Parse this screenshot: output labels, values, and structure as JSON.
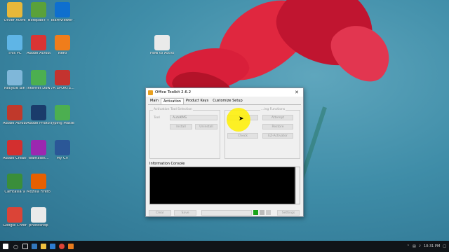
{
  "desktop": {
    "icons": [
      {
        "label": "Oliver Autre",
        "icon": "folder-icon",
        "color": "#e8b83a"
      },
      {
        "label": "Notepad++",
        "icon": "notepad-plus-plus-icon",
        "color": "#5aa13a"
      },
      {
        "label": "TeamViewer 11",
        "icon": "teamviewer-icon",
        "color": "#0e6fcf"
      },
      {
        "label": "This PC",
        "icon": "computer-icon",
        "color": "#5fb5e6"
      },
      {
        "label": "Adobe Acrobat X",
        "icon": "adobe-acrobat-icon",
        "color": "#d93434"
      },
      {
        "label": "Nero",
        "icon": "nero-icon",
        "color": "#f07d1b"
      },
      {
        "label": "How to Activate...",
        "icon": "document-icon",
        "color": "#eaeaea"
      },
      {
        "label": "Recycle Bin",
        "icon": "recycle-bin-icon",
        "color": "#7fb7d9"
      },
      {
        "label": "Internet Downlo...",
        "icon": "internet-download-manager-icon",
        "color": "#4caf50"
      },
      {
        "label": "7A SPORTS...",
        "icon": "cricket-game-icon",
        "color": "#c4332f"
      },
      {
        "label": "Adobe Acrobat...",
        "icon": "pdf-icon",
        "color": "#c0392b"
      },
      {
        "label": "Adobe Photosh...",
        "icon": "photoshop-icon",
        "color": "#1a3c6b"
      },
      {
        "label": "Typing Master 10",
        "icon": "typing-master-icon",
        "color": "#4caf50"
      },
      {
        "label": "Adobe Creative...",
        "icon": "creative-cloud-icon",
        "color": "#d32f2f"
      },
      {
        "label": "Wamatek...",
        "icon": "wamatek-icon",
        "color": "#9c27b0"
      },
      {
        "label": "My CV",
        "icon": "word-document-icon",
        "color": "#2b5797"
      },
      {
        "label": "Camtasia 9",
        "icon": "camtasia-icon",
        "color": "#3a8e3a"
      },
      {
        "label": "Mozilla Firefox",
        "icon": "firefox-icon",
        "color": "#e66000"
      },
      {
        "label": "Google Chrome",
        "icon": "chrome-icon",
        "color": "#db4437"
      },
      {
        "label": "photoshop",
        "icon": "document-icon",
        "color": "#eaeaea"
      }
    ]
  },
  "window": {
    "title": "Office Toolkit 2.6.2",
    "close_label": "✕",
    "tabs": [
      "Main",
      "Activation",
      "Product Keys",
      "Customize Setup"
    ],
    "active_tab": "Activation",
    "left_group_title": "Activation Tool Selection",
    "tool_label": "Tool",
    "tool_value": "AutoKMS",
    "install_label": "Install",
    "uninstall_label": "Uninstall",
    "right_group_title": "...ing Functions",
    "activate_label": "",
    "check_label": "Check",
    "ez_activator_label": "EZ-Activator",
    "attempt_label": "Attempt",
    "restore_label": "Restore",
    "console_label": "Information Console",
    "clear_label": "Clear",
    "save_label": "Save",
    "settings_label": "Settings"
  },
  "taskbar": {
    "time": "10:31 PM",
    "apps": [
      "start",
      "search",
      "task-view",
      "edge",
      "explorer",
      "store",
      "chrome",
      "office"
    ]
  },
  "colors": {
    "accent": "#f2e600",
    "status_green": "#19a319"
  }
}
